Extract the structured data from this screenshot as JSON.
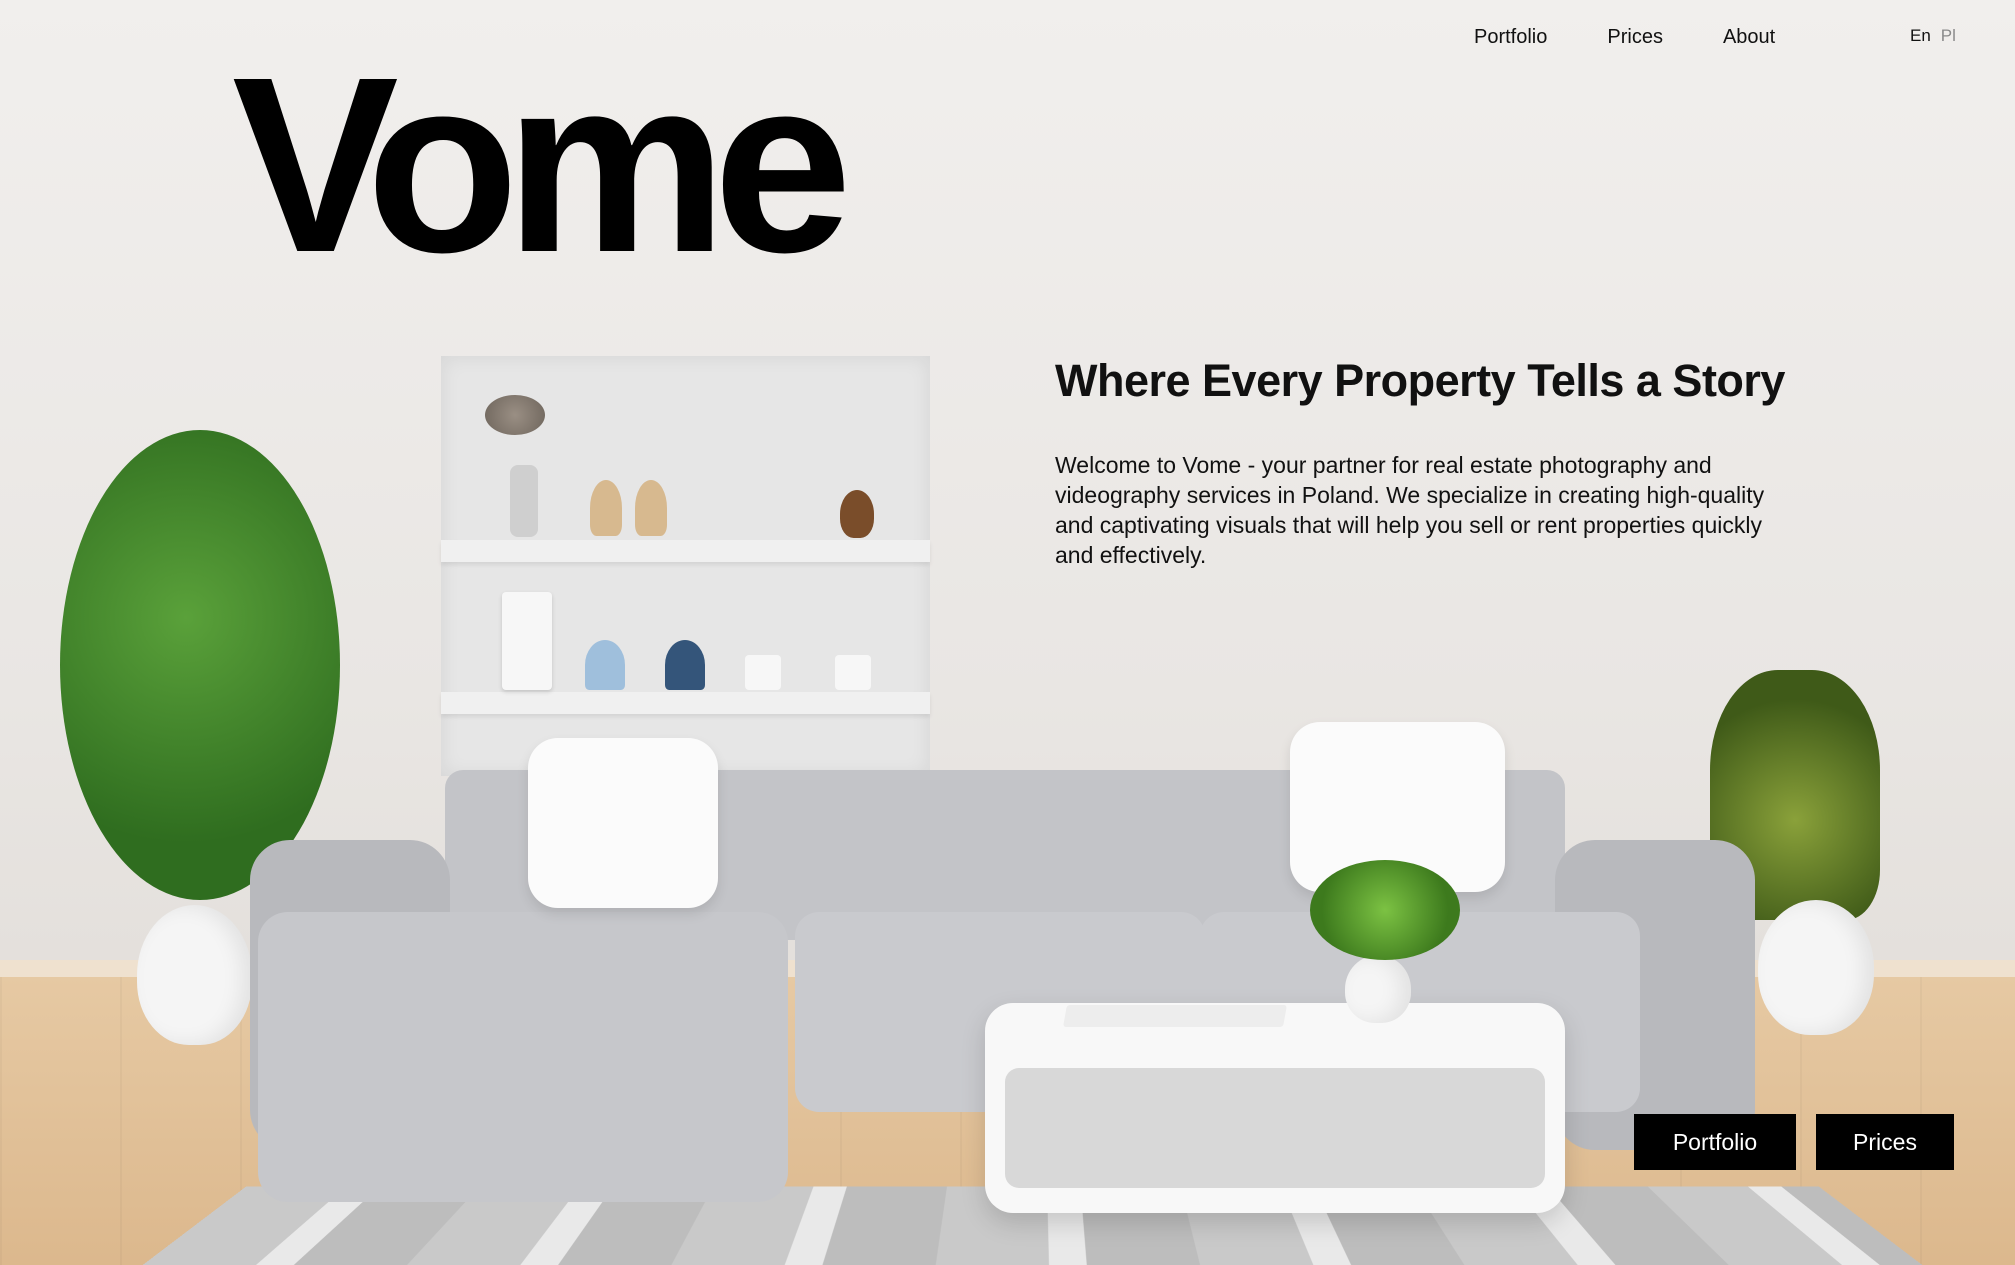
{
  "brand": {
    "name": "Vome"
  },
  "nav": {
    "items": [
      {
        "label": "Portfolio"
      },
      {
        "label": "Prices"
      },
      {
        "label": "About"
      }
    ]
  },
  "language": {
    "options": [
      "En",
      "Pl"
    ],
    "selected": "En"
  },
  "hero": {
    "headline": "Where Every Property Tells a Story",
    "intro": "Welcome to Vome - your partner for real estate photography and videography services in Poland. We specialize in creating high-quality and captivating visuals that will help you sell or rent properties quickly and effectively."
  },
  "cta": {
    "portfolio_label": "Portfolio",
    "prices_label": "Prices"
  },
  "colors": {
    "text": "#111111",
    "button_bg": "#000000",
    "button_text": "#ffffff",
    "inactive_language": "#8a8a8a"
  }
}
